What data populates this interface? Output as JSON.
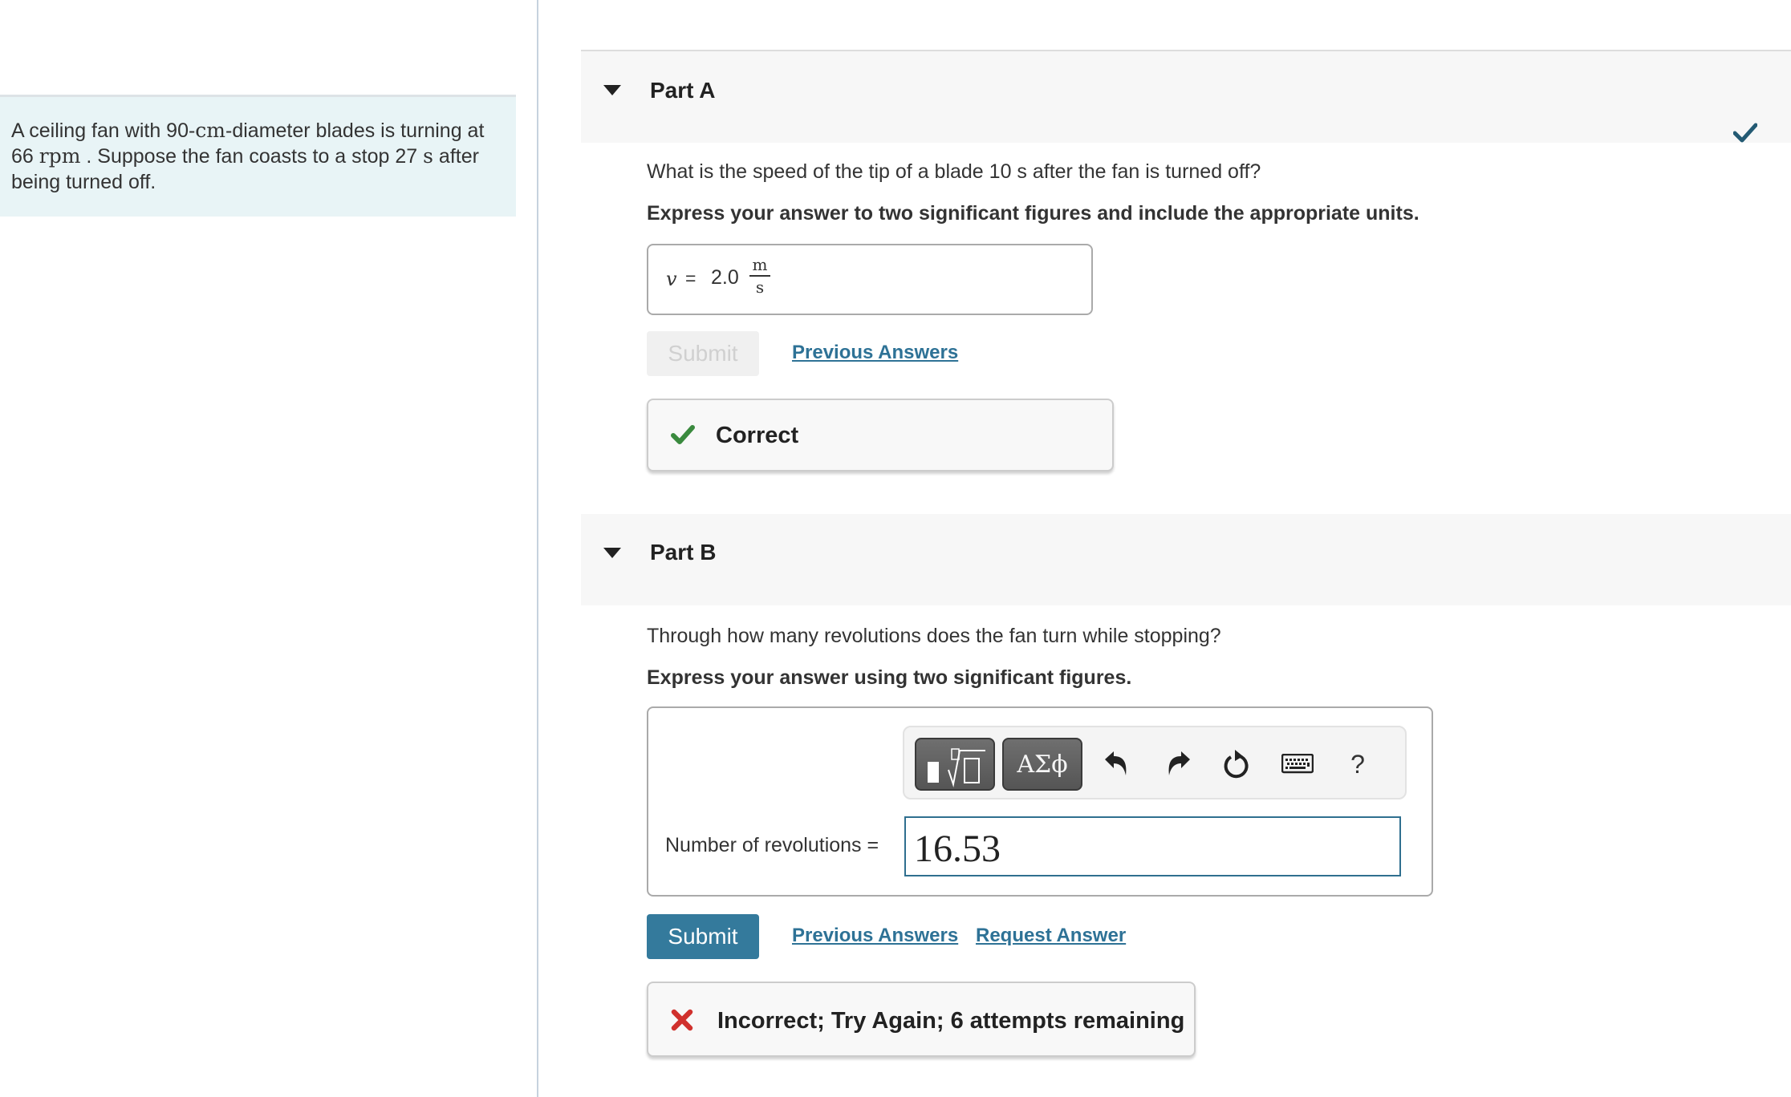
{
  "problem": {
    "text_parts": {
      "p1": "A ceiling fan with 90-",
      "u1": "cm",
      "p2": "-diameter blades is turning at 66 ",
      "u2": "rpm",
      "p3": " . Suppose the fan coasts to a stop 27 ",
      "u3": "s",
      "p4": " after being turned off."
    }
  },
  "partA": {
    "title": "Part A",
    "status": "correct",
    "question": "What is the speed of the tip of a blade 10 s after the fan is turned off?",
    "instruction": "Express your answer to two significant figures and include the appropriate units.",
    "answer": {
      "variable": "v",
      "equals": "=",
      "value": "2.0",
      "unit_numerator": "m",
      "unit_denominator": "s"
    },
    "submit_label": "Submit",
    "previous_answers_label": "Previous Answers",
    "feedback": {
      "icon": "check-icon",
      "message": "Correct",
      "color": "#3a8a3e"
    }
  },
  "partB": {
    "title": "Part B",
    "question": "Through how many revolutions does the fan turn while stopping?",
    "instruction": "Express your answer using two significant figures.",
    "toolbar": {
      "templates_label": "templates",
      "greek_label": "ΑΣϕ",
      "undo": "undo-icon",
      "redo": "redo-icon",
      "reset": "reset-icon",
      "keyboard": "keyboard-icon",
      "help_label": "?"
    },
    "input_label": "Number of revolutions =",
    "input_value": "16.53",
    "submit_label": "Submit",
    "previous_answers_label": "Previous Answers",
    "request_answer_label": "Request Answer",
    "feedback": {
      "icon": "x-icon",
      "message": "Incorrect; Try Again; 6 attempts remaining",
      "color": "#d0312d"
    }
  },
  "colors": {
    "accent": "#347a9c",
    "link": "#2e7296",
    "complete_check": "#235a73",
    "problem_bg": "#e8f4f6"
  }
}
